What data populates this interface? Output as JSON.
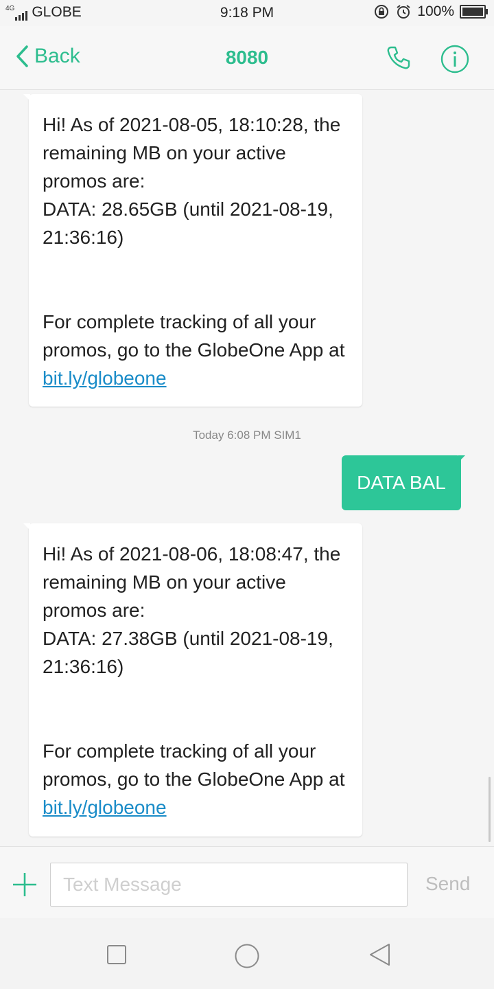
{
  "status_bar": {
    "network": "4G",
    "carrier": "GLOBE",
    "time": "9:18 PM",
    "battery_text": "100%",
    "battery_level": 1.0
  },
  "header": {
    "back_label": "Back",
    "title": "8080",
    "accent_color": "#2dbd8e"
  },
  "messages": {
    "first": {
      "text_intro": "Hi! As of 2021-08-05, 18:10:28, the remaining MB on your active promos are:\nDATA: 28.65GB (until 2021-08-19, 21:36:16)\n\n\nFor complete tracking of all your promos, go to the GlobeOne App at ",
      "link": "bit.ly/globeone"
    },
    "timestamp": "Today 6:08 PM  SIM1",
    "sent": {
      "text": "DATA BAL",
      "bubble_color": "#2dc698"
    },
    "second": {
      "text_intro": "Hi! As of 2021-08-06, 18:08:47, the remaining MB on your active promos are:\nDATA: 27.38GB (until 2021-08-19, 21:36:16)\n\n\nFor complete tracking of all your promos, go to the GlobeOne App at ",
      "link": "bit.ly/globeone"
    }
  },
  "composer": {
    "placeholder": "Text Message",
    "value": "",
    "send_label": "Send"
  },
  "icons": {
    "back": "chevron-left-icon",
    "call": "phone-icon",
    "info": "info-icon",
    "attach": "plus-icon",
    "nav_recents": "square-icon",
    "nav_home": "circle-icon",
    "nav_back": "triangle-icon"
  }
}
